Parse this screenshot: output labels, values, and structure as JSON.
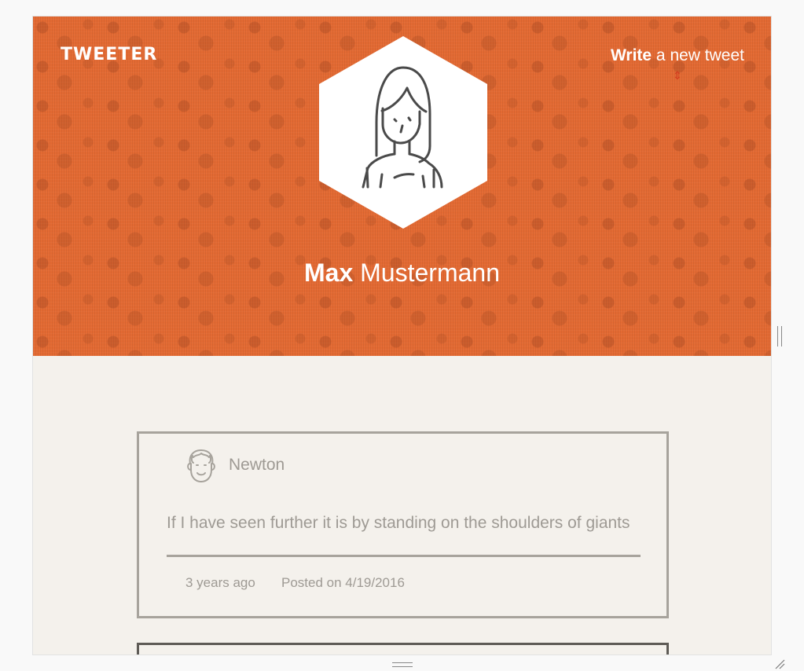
{
  "header": {
    "logo": "TWEETER",
    "write_bold": "Write",
    "write_rest": " a new tweet",
    "write_arrow": "⇕"
  },
  "profile": {
    "first_name": "Max",
    "last_name": " Mustermann"
  },
  "tweets": [
    {
      "author": "Newton",
      "text": "If I have seen further it is by standing on the shoulders of giants",
      "relative_time": "3 years ago",
      "posted": "Posted on 4/19/2016"
    }
  ],
  "colors": {
    "hero": "#e36a33",
    "page_bg": "#f4f1ec",
    "card_border": "#a7a39c",
    "muted_text": "#9e9a94"
  }
}
